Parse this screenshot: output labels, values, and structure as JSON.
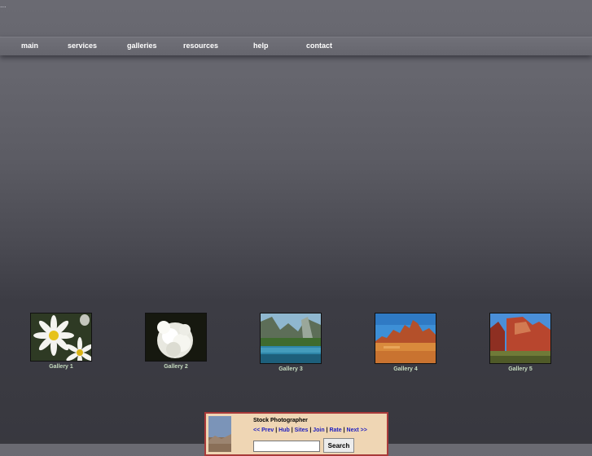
{
  "corner": {
    "text": "..."
  },
  "nav": {
    "items": [
      {
        "label": "main"
      },
      {
        "label": "services"
      },
      {
        "label": "galleries"
      },
      {
        "label": "resources"
      },
      {
        "label": "help"
      },
      {
        "label": "contact"
      }
    ]
  },
  "galleries": [
    {
      "label": "Gallery 1",
      "subject": "white daisies"
    },
    {
      "label": "Gallery 2",
      "subject": "white chrysanthemum"
    },
    {
      "label": "Gallery 3",
      "subject": "mountain lake valley"
    },
    {
      "label": "Gallery 4",
      "subject": "desert rock formations"
    },
    {
      "label": "Gallery 5",
      "subject": "red canyon cliffs"
    }
  ],
  "webring": {
    "title": "Stock Photographer",
    "prev": "<< Prev",
    "hub": "Hub",
    "sites": "Sites",
    "join": "Join",
    "rate": "Rate",
    "next": "Next >>",
    "separator": " | ",
    "search_button": "Search"
  },
  "colors": {
    "background_top": "#6a6a72",
    "background_bottom": "#38383f",
    "nav_text": "#ffffff",
    "gallery_label": "#c6dcc0",
    "webring_bg": "#efd6b4",
    "webring_border": "#a83a3a",
    "webring_link": "#2020c0"
  }
}
